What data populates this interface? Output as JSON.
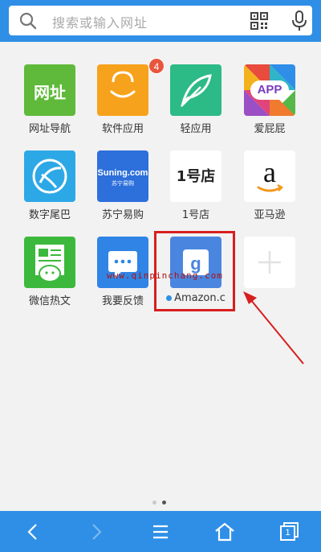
{
  "search": {
    "placeholder": "搜索或输入网址",
    "icons": [
      "search-icon",
      "qr-code-icon",
      "microphone-icon"
    ]
  },
  "tiles": [
    {
      "label": "网址导航",
      "icon_text": "网址",
      "color": "#5fb93a"
    },
    {
      "label": "软件应用",
      "badge": "4",
      "color": "#f7a21c"
    },
    {
      "label": "轻应用",
      "color": "#2cba86"
    },
    {
      "label": "爱屁屁",
      "icon_text": "APP",
      "color": "#ffffff"
    },
    {
      "label": "数字尾巴",
      "color": "#2da8e6"
    },
    {
      "label": "苏宁易购",
      "icon_text": "Suning.com",
      "icon_subtext": "苏宁易购",
      "color": "#2d6fdb"
    },
    {
      "label": "1号店",
      "icon_text": "1号店",
      "color": "#ffffff"
    },
    {
      "label": "亚马逊",
      "icon_text": "a",
      "color": "#ffffff"
    },
    {
      "label": "微信热文",
      "color": "#3cb93c"
    },
    {
      "label": "我要反馈",
      "color": "#2f84e6"
    },
    {
      "label": "Amazon.c",
      "color": "#4a86e0"
    },
    {
      "label": "",
      "color": "#ffffff"
    }
  ],
  "watermark": "www.qinpinchang.com",
  "page_indicator": {
    "pages": 2,
    "current": 2
  },
  "colors": {
    "accent": "#2f8fe6",
    "highlight": "#d81e1e"
  },
  "bottom_nav": [
    "back-icon",
    "forward-icon",
    "menu-icon",
    "home-icon",
    "tabs-icon"
  ],
  "tabs_count": "1"
}
